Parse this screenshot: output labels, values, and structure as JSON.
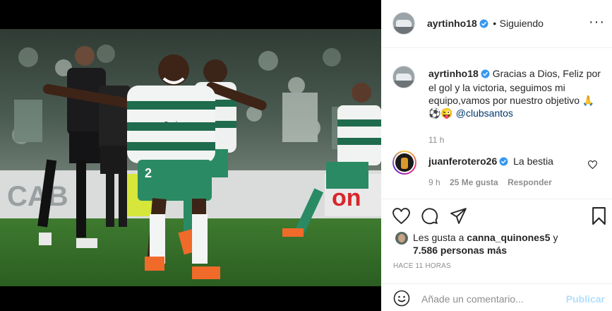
{
  "post": {
    "author": "ayrtinho18",
    "follow_status": "Siguiendo",
    "more_icon": "ellipsis-icon"
  },
  "caption": {
    "author": "ayrtinho18",
    "text": "Gracias a Dios, Feliz por el gol y la victoria, seguimos mi equipo,vamos por nuestro objetivo",
    "emojis": "🙏⚽😜",
    "mention": "@clubsantos",
    "time": "11 h"
  },
  "comments": [
    {
      "author": "juanferotero26",
      "text": "La bestia",
      "time": "9 h",
      "likes": "25 Me gusta",
      "reply": "Responder"
    }
  ],
  "actions": {
    "liked_by_prefix": "Les gusta a",
    "liked_by_user": "canna_quinones5",
    "liked_by_conj": "y",
    "likes_count": "7.586 personas más",
    "posted_ago": "HACE 11 HORAS"
  },
  "add_comment": {
    "placeholder": "Añade un comentario...",
    "publish": "Publicar"
  },
  "colors": {
    "verified": "#3897f0",
    "link": "#00376b",
    "muted": "#8e8e8e",
    "publish_disabled": "#b2dffc",
    "santos_green": "#1f6b4e"
  }
}
